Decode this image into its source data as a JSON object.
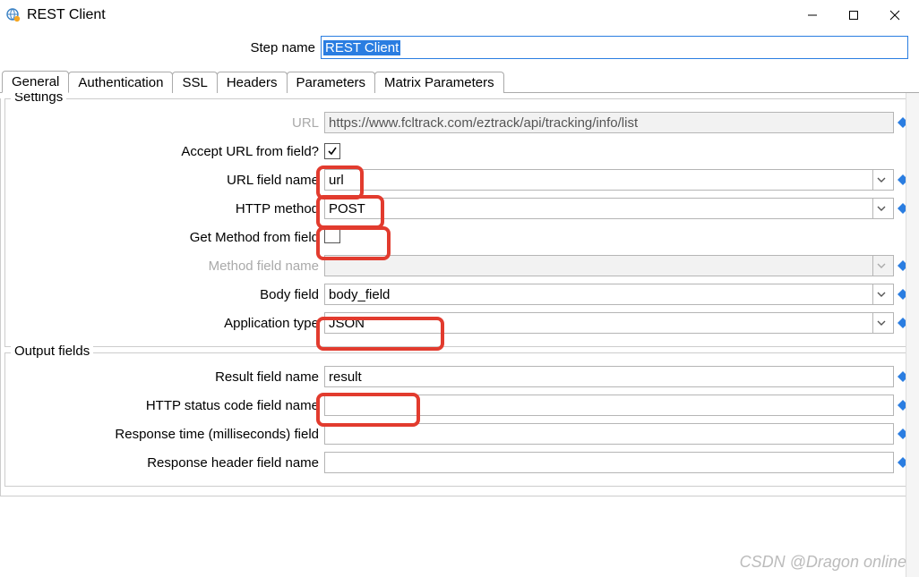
{
  "window": {
    "title": "REST Client"
  },
  "step": {
    "label": "Step name",
    "value": "REST Client"
  },
  "tabs": [
    "General",
    "Authentication",
    "SSL",
    "Headers",
    "Parameters",
    "Matrix Parameters"
  ],
  "active_tab": 0,
  "settings": {
    "legend": "Settings",
    "url_label": "URL",
    "url_value": "https://www.fcltrack.com/eztrack/api/tracking/info/list",
    "accept_url_label": "Accept URL from field?",
    "accept_url_checked": true,
    "url_field_label": "URL field name",
    "url_field_value": "url",
    "http_method_label": "HTTP method",
    "http_method_value": "POST",
    "get_method_label": "Get Method from field",
    "get_method_checked": false,
    "method_field_label": "Method field name",
    "method_field_value": "",
    "body_field_label": "Body field",
    "body_field_value": "body_field",
    "app_type_label": "Application type",
    "app_type_value": "JSON"
  },
  "output": {
    "legend": "Output fields",
    "result_label": "Result field name",
    "result_value": "result",
    "status_label": "HTTP status code field name",
    "status_value": "",
    "resptime_label": "Response time (milliseconds) field",
    "resptime_value": "",
    "respheader_label": "Response header field name",
    "respheader_value": ""
  },
  "watermark": "CSDN @Dragon online"
}
